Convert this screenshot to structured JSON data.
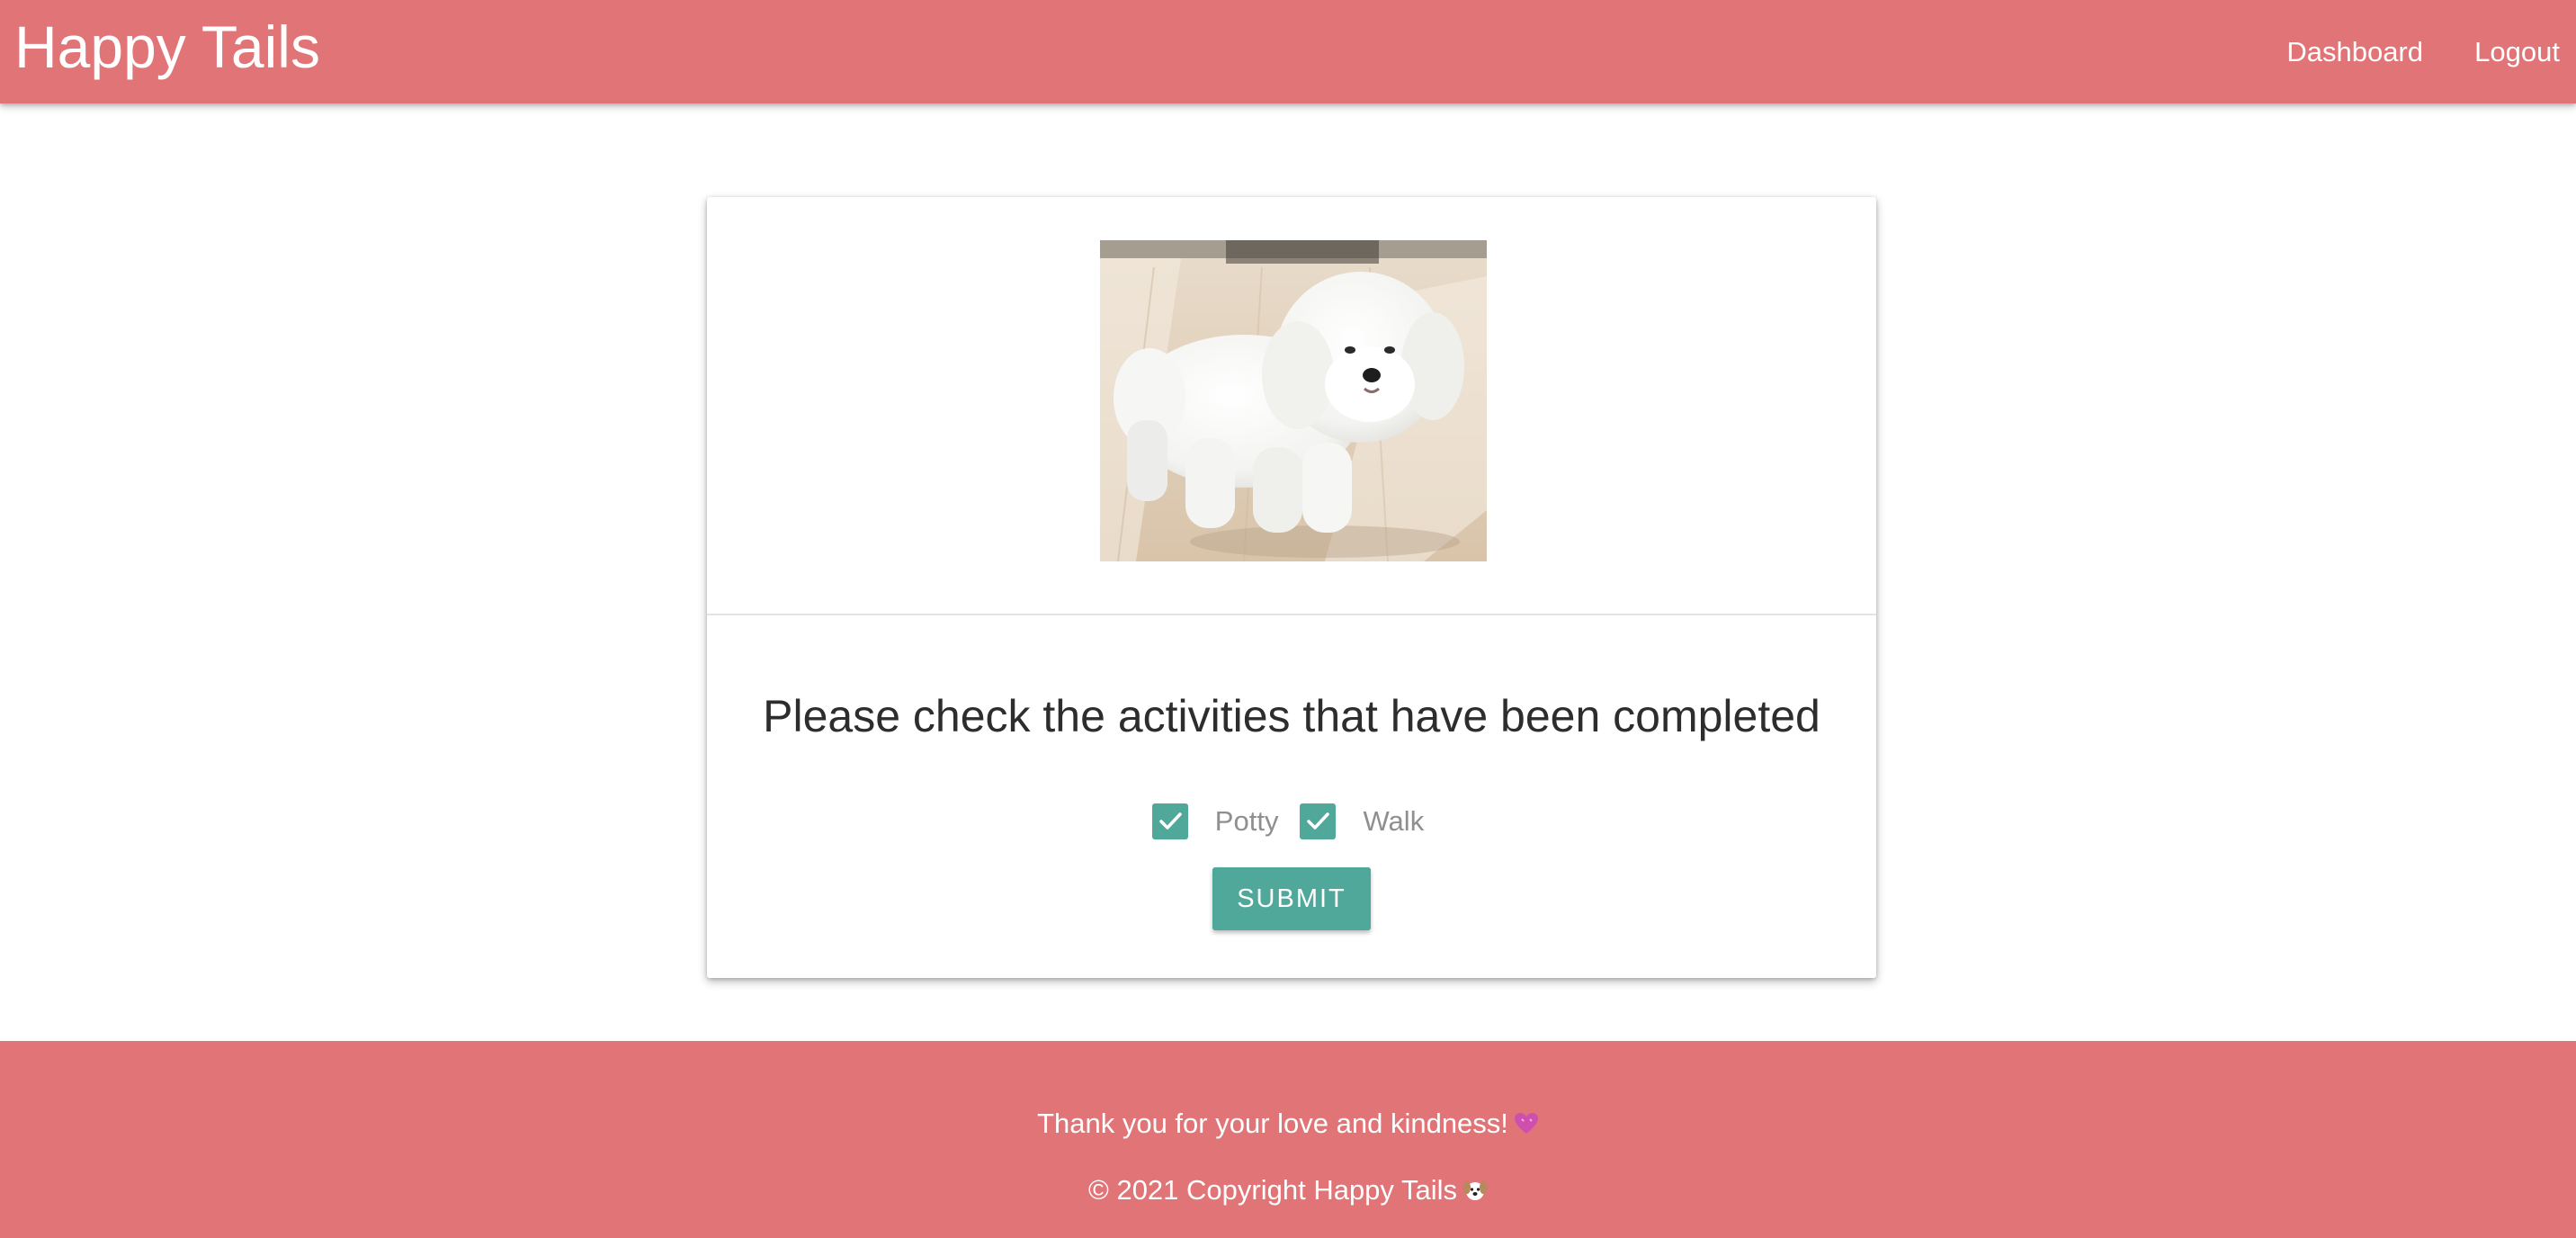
{
  "navbar": {
    "brand": "Happy Tails",
    "links": [
      "Dashboard",
      "Logout"
    ]
  },
  "card": {
    "image": {
      "icon": "dog-photo",
      "description_visible": false
    },
    "title": "Please check the activities that have been completed",
    "activities": [
      {
        "label": "Potty",
        "checked": true
      },
      {
        "label": "Walk",
        "checked": true
      }
    ],
    "submit_label": "SUBMIT"
  },
  "footer": {
    "thanks": "Thank you for your love and kindness!",
    "thanks_icon": "heart-icon",
    "copyright": "© 2021 Copyright Happy Tails",
    "copyright_icon": "dog-face-icon"
  },
  "colors": {
    "primary": "#e07476",
    "accent": "#4fa89a"
  }
}
